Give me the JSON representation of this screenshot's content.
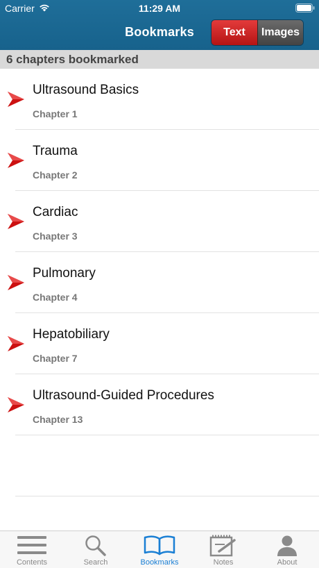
{
  "status_bar": {
    "carrier": "Carrier",
    "time": "11:29 AM"
  },
  "nav": {
    "title": "Bookmarks",
    "segments": [
      {
        "label": "Text",
        "selected": true
      },
      {
        "label": "Images",
        "selected": false
      }
    ]
  },
  "section": {
    "header": "6 chapters bookmarked"
  },
  "bookmarks": [
    {
      "title": "Ultrasound Basics",
      "chapter": "Chapter 1"
    },
    {
      "title": "Trauma",
      "chapter": "Chapter 2"
    },
    {
      "title": "Cardiac",
      "chapter": "Chapter 3"
    },
    {
      "title": "Pulmonary",
      "chapter": "Chapter 4"
    },
    {
      "title": "Hepatobiliary",
      "chapter": "Chapter 7"
    },
    {
      "title": "Ultrasound-Guided Procedures",
      "chapter": "Chapter 13"
    }
  ],
  "tab_bar": {
    "tabs": [
      {
        "label": "Contents",
        "icon": "list-icon"
      },
      {
        "label": "Search",
        "icon": "search-icon"
      },
      {
        "label": "Bookmarks",
        "icon": "open-book-icon",
        "active": true
      },
      {
        "label": "Notes",
        "icon": "notepad-icon"
      },
      {
        "label": "About",
        "icon": "person-icon"
      }
    ]
  },
  "colors": {
    "nav_bar": "#1a6893",
    "segment_selected": "#cc2222",
    "segment_unselected": "#555555",
    "bookmark_arrow": "#cc1111",
    "tab_active": "#1a7fd4",
    "tab_inactive": "#888888"
  }
}
